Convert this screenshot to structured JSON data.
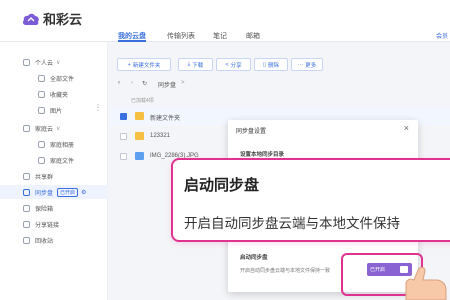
{
  "app": {
    "name": "和彩云"
  },
  "header": {
    "nav": [
      "我的云盘",
      "传输列表",
      "笔记",
      "邮箱"
    ],
    "active_index": 0,
    "help": "会员"
  },
  "sidebar": {
    "items": [
      {
        "label": "个人云",
        "level": 1,
        "icon": "user-cloud-icon",
        "chevron": "∨"
      },
      {
        "label": "全部文件",
        "level": 2,
        "icon": "all-files-icon"
      },
      {
        "label": "收藏夹",
        "level": 2,
        "icon": "favorites-icon"
      },
      {
        "label": "图片",
        "level": 2,
        "icon": "image-icon"
      },
      {
        "label": "家庭云",
        "level": 1,
        "icon": "family-cloud-icon",
        "chevron": "∨"
      },
      {
        "label": "家庭相册",
        "level": 2,
        "icon": "family-album-icon"
      },
      {
        "label": "家庭文件",
        "level": 2,
        "icon": "family-files-icon"
      },
      {
        "label": "共享群",
        "level": 1,
        "icon": "share-group-icon"
      },
      {
        "label": "同步盘",
        "level": 1,
        "icon": "sync-drive-icon",
        "badge": "已开启",
        "active": true
      },
      {
        "label": "保险箱",
        "level": 1,
        "icon": "safe-icon"
      },
      {
        "label": "分享链接",
        "level": 1,
        "icon": "share-link-icon"
      },
      {
        "label": "回收站",
        "level": 1,
        "icon": "recycle-bin-icon"
      }
    ],
    "more": "⋮"
  },
  "toolbar": {
    "new_folder": "新建文件夹",
    "download": "下载",
    "share": "分享",
    "delete": "删除",
    "more": "更多"
  },
  "breadcrumb": {
    "current": "同步盘",
    "separator": ">"
  },
  "file_list": {
    "loaded_text": "已加载4项",
    "rows": [
      {
        "name": "新建文件夹",
        "type": "folder",
        "checked": true
      },
      {
        "name": "123321",
        "type": "folder",
        "checked": false
      },
      {
        "name": "IMG_2286(3).JPG",
        "type": "image",
        "checked": false
      }
    ]
  },
  "dialog": {
    "title": "同步盘设置",
    "close": "×",
    "section1": "设置本地同步目录",
    "section2": "启动同步盘",
    "section2_desc": "开启自动同步盘云端与本地文件保持一致",
    "button_label": "已开启"
  },
  "callout": {
    "title": "启动同步盘",
    "desc": "开启自动同步盘云端与本地文件保持"
  },
  "colors": {
    "accent": "#3a6fe0",
    "highlight": "#e0338f",
    "toggle": "#8a63d2"
  }
}
